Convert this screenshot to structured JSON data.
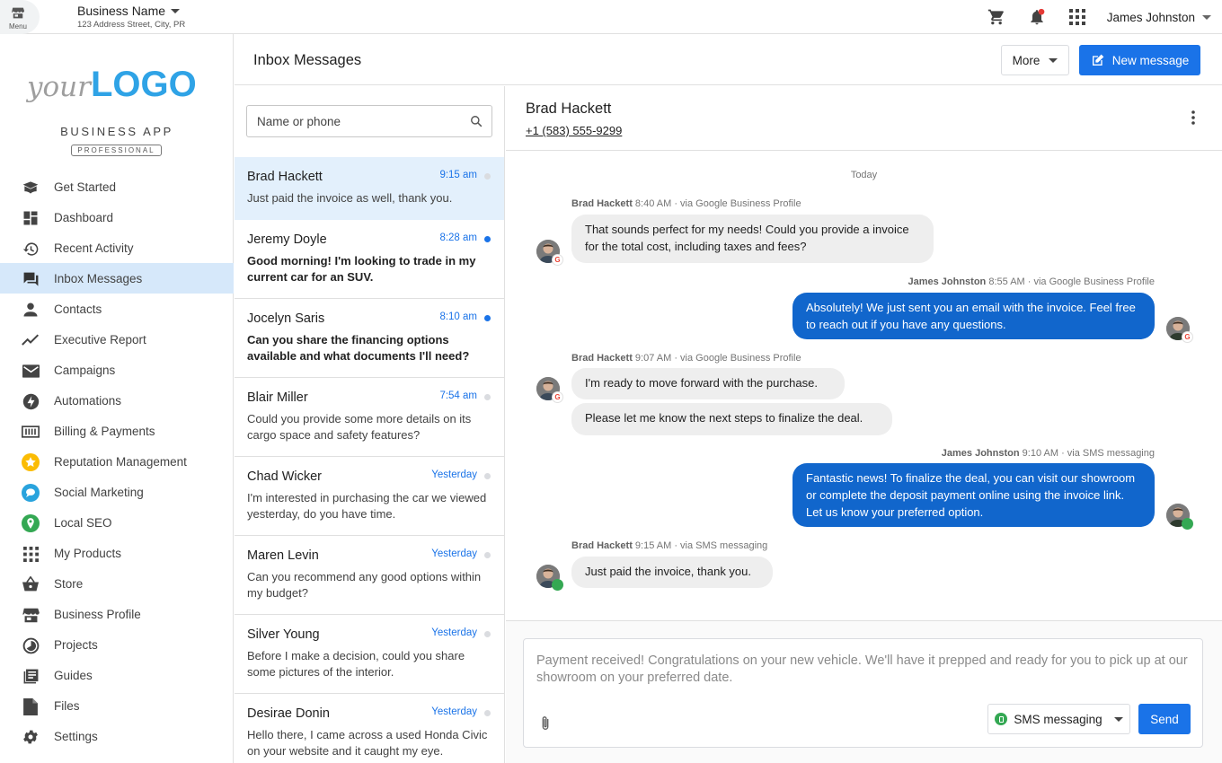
{
  "topbar": {
    "menu_label": "Menu",
    "business_name": "Business Name",
    "business_address": "123 Address Street, City, PR",
    "user_name": "James Johnston"
  },
  "sidebar": {
    "logo_your": "your",
    "logo_big": "LOGO",
    "app_name": "BUSINESS APP",
    "app_tier": "PROFESSIONAL",
    "items": [
      {
        "label": "Get Started",
        "icon": "book-icon"
      },
      {
        "label": "Dashboard",
        "icon": "dashboard-icon"
      },
      {
        "label": "Recent Activity",
        "icon": "history-icon"
      },
      {
        "label": "Inbox Messages",
        "icon": "chat-icon",
        "active": true
      },
      {
        "label": "Contacts",
        "icon": "person-icon"
      },
      {
        "label": "Executive Report",
        "icon": "trending-icon"
      },
      {
        "label": "Campaigns",
        "icon": "mail-icon"
      },
      {
        "label": "Automations",
        "icon": "bolt-icon"
      },
      {
        "label": "Billing & Payments",
        "icon": "billing-icon"
      },
      {
        "label": "Reputation Management",
        "icon": "star-icon"
      },
      {
        "label": "Social Marketing",
        "icon": "social-icon"
      },
      {
        "label": "Local SEO",
        "icon": "pin-icon"
      },
      {
        "label": "My Products",
        "icon": "apps-grid-icon"
      },
      {
        "label": "Store",
        "icon": "basket-icon"
      },
      {
        "label": "Business Profile",
        "icon": "storefront-icon"
      },
      {
        "label": "Projects",
        "icon": "projects-icon"
      },
      {
        "label": "Guides",
        "icon": "guides-icon"
      },
      {
        "label": "Files",
        "icon": "file-icon"
      },
      {
        "label": "Settings",
        "icon": "gear-icon"
      }
    ]
  },
  "header": {
    "title": "Inbox Messages",
    "more_label": "More",
    "new_message_label": "New message"
  },
  "search": {
    "placeholder": "Name or phone",
    "value": ""
  },
  "conversations": [
    {
      "name": "Brad Hackett",
      "time": "9:15 am",
      "preview": "Just paid the invoice as well, thank you.",
      "unread": false
    },
    {
      "name": "Jeremy Doyle",
      "time": "8:28 am",
      "preview": "Good morning! I'm looking to trade in my current car for an SUV.",
      "unread": true
    },
    {
      "name": "Jocelyn Saris",
      "time": "8:10 am",
      "preview": "Can you share the financing options available and what documents I'll need?",
      "unread": true
    },
    {
      "name": "Blair Miller",
      "time": "7:54 am",
      "preview": "Could you provide some more details on its cargo space and safety features?",
      "unread": false
    },
    {
      "name": "Chad Wicker",
      "time": "Yesterday",
      "preview": "I'm interested in purchasing the car we viewed yesterday, do you have time.",
      "unread": false
    },
    {
      "name": "Maren Levin",
      "time": "Yesterday",
      "preview": "Can you recommend any good options within my budget?",
      "unread": false
    },
    {
      "name": "Silver Young",
      "time": "Yesterday",
      "preview": "Before I make a decision, could you share some pictures of the interior.",
      "unread": false
    },
    {
      "name": "Desirae Donin",
      "time": "Yesterday",
      "preview": "Hello there, I came across a used Honda Civic on your website and it caught my eye.",
      "unread": false
    }
  ],
  "thread": {
    "name": "Brad Hackett",
    "phone": "+1 (583) 555-9299",
    "day_label": "Today",
    "groups": [
      {
        "sender": "Brad Hackett",
        "info": " 8:40 AM · via Google Business Profile",
        "bubbles": [
          "That sounds perfect for my needs! Could you provide a invoice for the total cost, including taxes and fees?"
        ]
      },
      {
        "sender": "James Johnston",
        "info": " 8:55 AM · via Google Business Profile",
        "bubbles": [
          "Absolutely! We just sent you an email with the invoice. Feel free to reach out if you have any questions."
        ]
      },
      {
        "sender": "Brad Hackett",
        "info": " 9:07 AM · via Google Business Profile",
        "bubbles": [
          "I'm ready to move forward with the purchase.",
          "Please let me know the next steps to finalize the deal."
        ]
      },
      {
        "sender": "James Johnston",
        "info": " 9:10 AM · via SMS messaging",
        "bubbles": [
          "Fantastic news! To finalize the deal, you can visit our showroom or complete the deposit payment online using the invoice link. Let us know your preferred option."
        ]
      },
      {
        "sender": "Brad Hackett",
        "info": " 9:15 AM · via SMS messaging",
        "bubbles": [
          "Just paid the invoice, thank you."
        ]
      }
    ]
  },
  "composer": {
    "text": "Payment received! Congratulations on your new vehicle. We'll have it prepped and ready for you to pick up at our showroom on your preferred date.",
    "channel_label": "SMS messaging",
    "send_label": "Send"
  },
  "colors": {
    "accent": "#1a73e8",
    "outgoing_bubble": "#1166cc",
    "active_nav": "#d6e8fa",
    "logo_blue": "#2fa3e6"
  }
}
